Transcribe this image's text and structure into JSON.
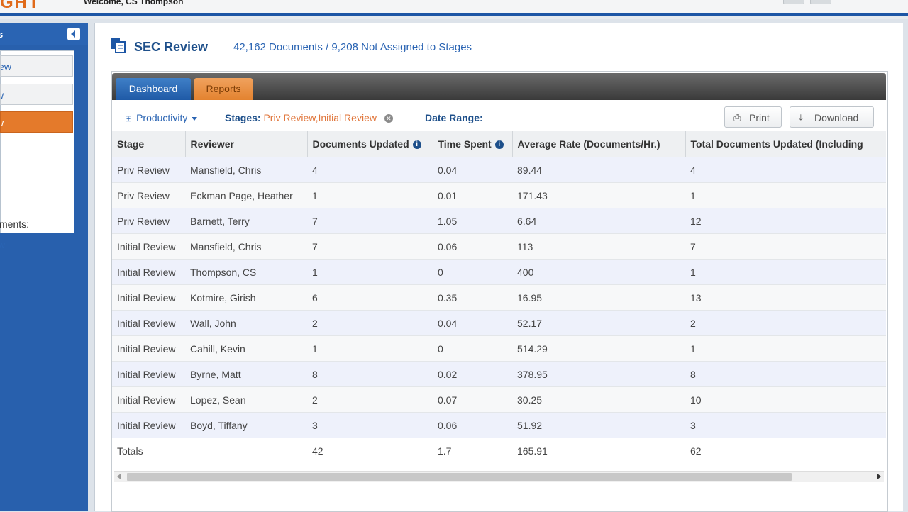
{
  "header": {
    "logo_text": "GHT",
    "welcome": "Welcome, CS Thompson"
  },
  "sidebar": {
    "title": "s",
    "items": [
      {
        "label": "iew"
      },
      {
        "label": "w"
      },
      {
        "label": "w"
      }
    ],
    "text1": "ments:",
    "text2": "w"
  },
  "main": {
    "title": "SEC Review",
    "doc_count": "42,162 Documents / 9,208 Not Assigned to Stages"
  },
  "tabs": [
    {
      "label": "Dashboard"
    },
    {
      "label": "Reports"
    }
  ],
  "toolbar": {
    "productivity": "Productivity",
    "stages_label": "Stages:",
    "stages_value": "Priv Review,Initial Review",
    "date_label": "Date Range:",
    "print": "Print",
    "download": "Download"
  },
  "table": {
    "headers": [
      "Stage",
      "Reviewer",
      "Documents Updated",
      "Time Spent",
      "Average Rate (Documents/Hr.)",
      "Total Documents Updated (Including"
    ],
    "rows": [
      [
        "Priv Review",
        "Mansfield, Chris",
        "4",
        "0.04",
        "89.44",
        "4"
      ],
      [
        "Priv Review",
        "Eckman Page, Heather",
        "1",
        "0.01",
        "171.43",
        "1"
      ],
      [
        "Priv Review",
        "Barnett, Terry",
        "7",
        "1.05",
        "6.64",
        "12"
      ],
      [
        "Initial Review",
        "Mansfield, Chris",
        "7",
        "0.06",
        "113",
        "7"
      ],
      [
        "Initial Review",
        "Thompson, CS",
        "1",
        "0",
        "400",
        "1"
      ],
      [
        "Initial Review",
        "Kotmire, Girish",
        "6",
        "0.35",
        "16.95",
        "13"
      ],
      [
        "Initial Review",
        "Wall, John",
        "2",
        "0.04",
        "52.17",
        "2"
      ],
      [
        "Initial Review",
        "Cahill, Kevin",
        "1",
        "0",
        "514.29",
        "1"
      ],
      [
        "Initial Review",
        "Byrne, Matt",
        "8",
        "0.02",
        "378.95",
        "8"
      ],
      [
        "Initial Review",
        "Lopez, Sean",
        "2",
        "0.07",
        "30.25",
        "10"
      ],
      [
        "Initial Review",
        "Boyd, Tiffany",
        "3",
        "0.06",
        "51.92",
        "3"
      ]
    ],
    "totals": [
      "Totals",
      "",
      "42",
      "1.7",
      "165.91",
      "62"
    ]
  }
}
